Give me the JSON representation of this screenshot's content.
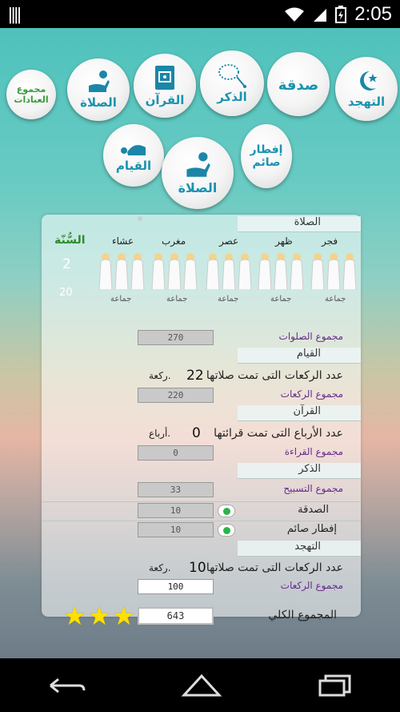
{
  "status_bar": {
    "time": "2:05"
  },
  "top_buttons": [
    {
      "name": "tahajjud",
      "label": "التهجد"
    },
    {
      "name": "sadaqa",
      "label": "صدقة"
    },
    {
      "name": "dhikr",
      "label": "الذكر"
    },
    {
      "name": "quran",
      "label": "القرآن"
    },
    {
      "name": "salah",
      "label": "الصلاة"
    }
  ],
  "sum_worship": {
    "line1": "مجموع",
    "line2": "العبادات"
  },
  "row2_buttons": [
    {
      "name": "iftar",
      "line1": "إفطار",
      "line2": "صائم"
    },
    {
      "name": "salah-selected",
      "label": "الصلاة"
    },
    {
      "name": "qiyam",
      "label": "القيام"
    }
  ],
  "panel": {
    "prayer_header": "الصلاة",
    "prayer_names": [
      "فجر",
      "ظهر",
      "عصر",
      "مغرب",
      "عشاء"
    ],
    "sunna_label": "السُّنّة",
    "jamaa_label": "جماعة",
    "sunna_count": "2",
    "sunna_total": "20",
    "prayers_sum_label": "مجموع الصلوات",
    "prayers_sum": "270",
    "qiyam_header": "القيام",
    "qiyam_text": "عدد الركعات التى تمت صلاتها",
    "qiyam_count": "22",
    "qiyam_unit": "ركعة.",
    "qiyam_sum_label": "مجموع الركعات",
    "qiyam_sum": "220",
    "quran_header": "القرآن",
    "quran_text": "عدد الأرباع التى تمت قرائتها",
    "quran_count": "0",
    "quran_unit": "أرباع.",
    "quran_sum_label": "مجموع القراءة",
    "quran_sum": "0",
    "dhikr_header": "الذكر",
    "dhikr_sum_label": "مجموع التسبيح",
    "dhikr_sum": "33",
    "sadaqa_label": "الصدقة",
    "sadaqa_value": "10",
    "iftar_label": "إفطار صائم",
    "iftar_value": "10",
    "tahajjud_header": "التهجد",
    "tahajjud_text": "عدد الركعات التى تمت صلاتها",
    "tahajjud_count": "10",
    "tahajjud_unit": "ركعة.",
    "tahajjud_sum_label": "مجموع الركعات",
    "tahajjud_sum": "100",
    "total_label": "المجموع الكلي",
    "total_value": "643",
    "stars": 3
  }
}
